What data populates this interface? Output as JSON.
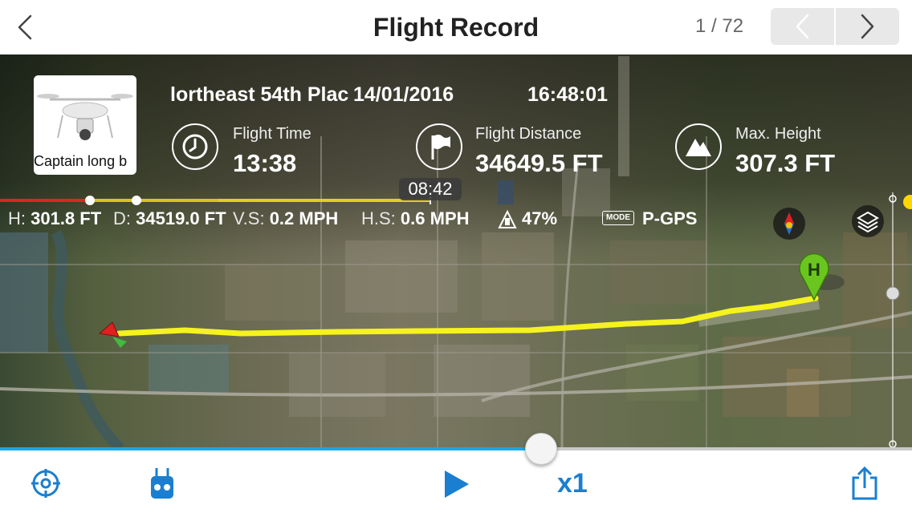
{
  "header": {
    "title": "Flight Record",
    "page_indicator": "1 / 72"
  },
  "aircraft": {
    "name": "Captain long b"
  },
  "flight": {
    "location": "lortheast 54th Plac",
    "date": "14/01/2016",
    "time": "16:48:01"
  },
  "stats": [
    {
      "label": "Flight Time",
      "value": "13:38",
      "icon": "clock-icon"
    },
    {
      "label": "Flight Distance",
      "value": "34649.5 FT",
      "icon": "flag-icon"
    },
    {
      "label": "Max. Height",
      "value": "307.3 FT",
      "icon": "mountain-icon"
    }
  ],
  "timeline": {
    "current_time": "08:42"
  },
  "telemetry": {
    "height_label": "H:",
    "height_value": "301.8 FT",
    "distance_label": "D:",
    "distance_value": "34519.0 FT",
    "vs_label": "V.S:",
    "vs_value": "0.2 MPH",
    "hs_label": "H.S:",
    "hs_value": "0.6 MPH",
    "battery_value": "47%",
    "mode_badge": "MODE",
    "mode_value": "P-GPS"
  },
  "map": {
    "home_marker": "H",
    "flight_path_color": "#f5f21e"
  },
  "playback": {
    "progress": 0.593,
    "speed": "x1"
  },
  "colors": {
    "accent": "#1a7fd0",
    "progress_fill": "#1aa6e8",
    "home_marker": "#6ac61e",
    "aircraft_marker": "#e02020"
  }
}
